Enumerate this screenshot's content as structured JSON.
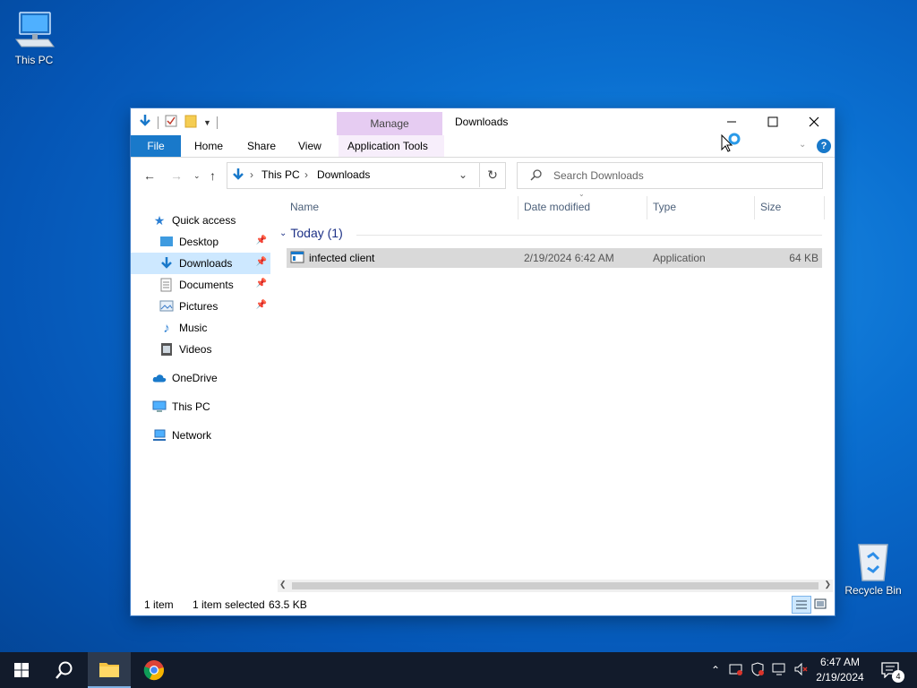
{
  "desktop": {
    "icons": [
      {
        "label": "This PC"
      },
      {
        "label": "Recycle Bin"
      }
    ]
  },
  "window": {
    "title": "Downloads",
    "context_tab": "Manage",
    "ribbon_tabs": [
      "File",
      "Home",
      "Share",
      "View",
      "Application Tools"
    ],
    "breadcrumb": [
      "This PC",
      "Downloads"
    ],
    "search_placeholder": "Search Downloads",
    "columns": [
      "Name",
      "Date modified",
      "Type",
      "Size"
    ],
    "group_label": "Today (1)",
    "files": [
      {
        "name": "infected client",
        "date": "2/19/2024 6:42 AM",
        "type": "Application",
        "size": "64 KB"
      }
    ],
    "nav": {
      "quick_access": "Quick access",
      "items": [
        "Desktop",
        "Downloads",
        "Documents",
        "Pictures",
        "Music",
        "Videos"
      ],
      "onedrive": "OneDrive",
      "thispc": "This PC",
      "network": "Network"
    },
    "status": {
      "count": "1 item",
      "selected": "1 item selected",
      "size": "63.5 KB"
    }
  },
  "taskbar": {
    "time": "6:47 AM",
    "date": "2/19/2024",
    "notification_count": "4"
  },
  "colors": {
    "accent": "#1979ca",
    "selection": "#cde8ff",
    "manage_tab": "#e6ccf2",
    "taskbar": "#121b2b"
  }
}
